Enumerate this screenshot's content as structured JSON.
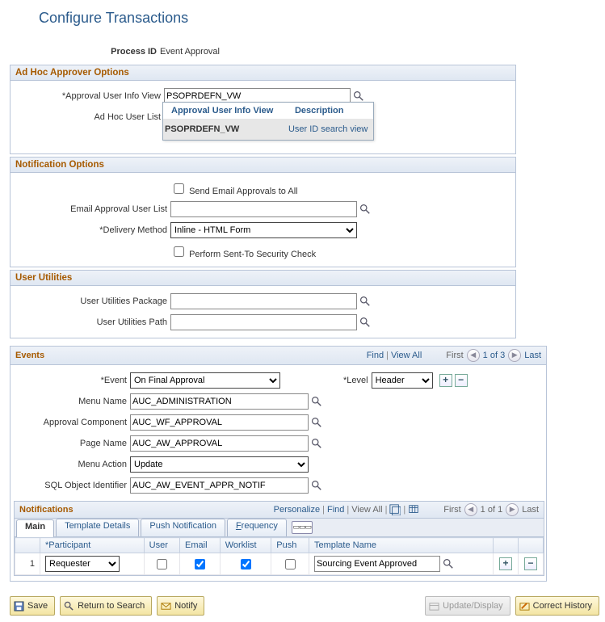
{
  "title": "Configure Transactions",
  "process_id": {
    "label": "Process ID",
    "value": "Event Approval"
  },
  "ad_hoc": {
    "heading": "Ad Hoc Approver Options",
    "user_info_view": {
      "label": "*Approval User Info View",
      "value": "PSOPRDEFN_VW"
    },
    "user_list": {
      "label": "Ad Hoc User List"
    },
    "popup": {
      "col1": "Approval User Info View",
      "col2": "Description",
      "row": {
        "c1": "PSOPRDEFN_VW",
        "c2": "User ID search view"
      }
    }
  },
  "notif_opt": {
    "heading": "Notification Options",
    "send_all": {
      "label": "Send Email Approvals to All",
      "checked": false
    },
    "email_user_list": {
      "label": "Email Approval User List",
      "value": ""
    },
    "delivery": {
      "label": "*Delivery Method",
      "value": "Inline - HTML Form"
    },
    "sent_to_check": {
      "label": "Perform Sent-To Security Check",
      "checked": false
    }
  },
  "user_util": {
    "heading": "User Utilities",
    "package": {
      "label": "User Utilities Package",
      "value": ""
    },
    "path": {
      "label": "User Utilities Path",
      "value": ""
    }
  },
  "events": {
    "heading": "Events",
    "nav": {
      "find": "Find",
      "view_all": "View All",
      "first": "First",
      "range": "1 of 3",
      "last": "Last"
    },
    "event": {
      "label": "*Event",
      "value": "On Final Approval"
    },
    "level": {
      "label": "*Level",
      "value": "Header"
    },
    "menu_name": {
      "label": "Menu Name",
      "value": "AUC_ADMINISTRATION"
    },
    "appr_comp": {
      "label": "Approval Component",
      "value": "AUC_WF_APPROVAL"
    },
    "page_name": {
      "label": "Page Name",
      "value": "AUC_AW_APPROVAL"
    },
    "menu_action": {
      "label": "Menu Action",
      "value": "Update"
    },
    "sql_obj": {
      "label": "SQL Object Identifier",
      "value": "AUC_AW_EVENT_APPR_NOTIF"
    }
  },
  "notifications": {
    "heading": "Notifications",
    "links": {
      "personalize": "Personalize",
      "find": "Find",
      "view_all": "View All"
    },
    "nav": {
      "first": "First",
      "range": "1 of 1",
      "last": "Last"
    },
    "tabs": {
      "main": "Main",
      "tdetails": "Template Details",
      "push": "Push Notification",
      "freq": "Frequency"
    },
    "cols": {
      "row": "",
      "participant": "*Participant",
      "user": "User",
      "email": "Email",
      "worklist": "Worklist",
      "push": "Push",
      "template": "Template Name"
    },
    "row": {
      "num": "1",
      "participant": "Requester",
      "user": false,
      "email": true,
      "worklist": true,
      "push": false,
      "template": "Sourcing Event Approved"
    }
  },
  "footer": {
    "save": "Save",
    "return": "Return to Search",
    "notify": "Notify",
    "update": "Update/Display",
    "correct": "Correct History"
  }
}
